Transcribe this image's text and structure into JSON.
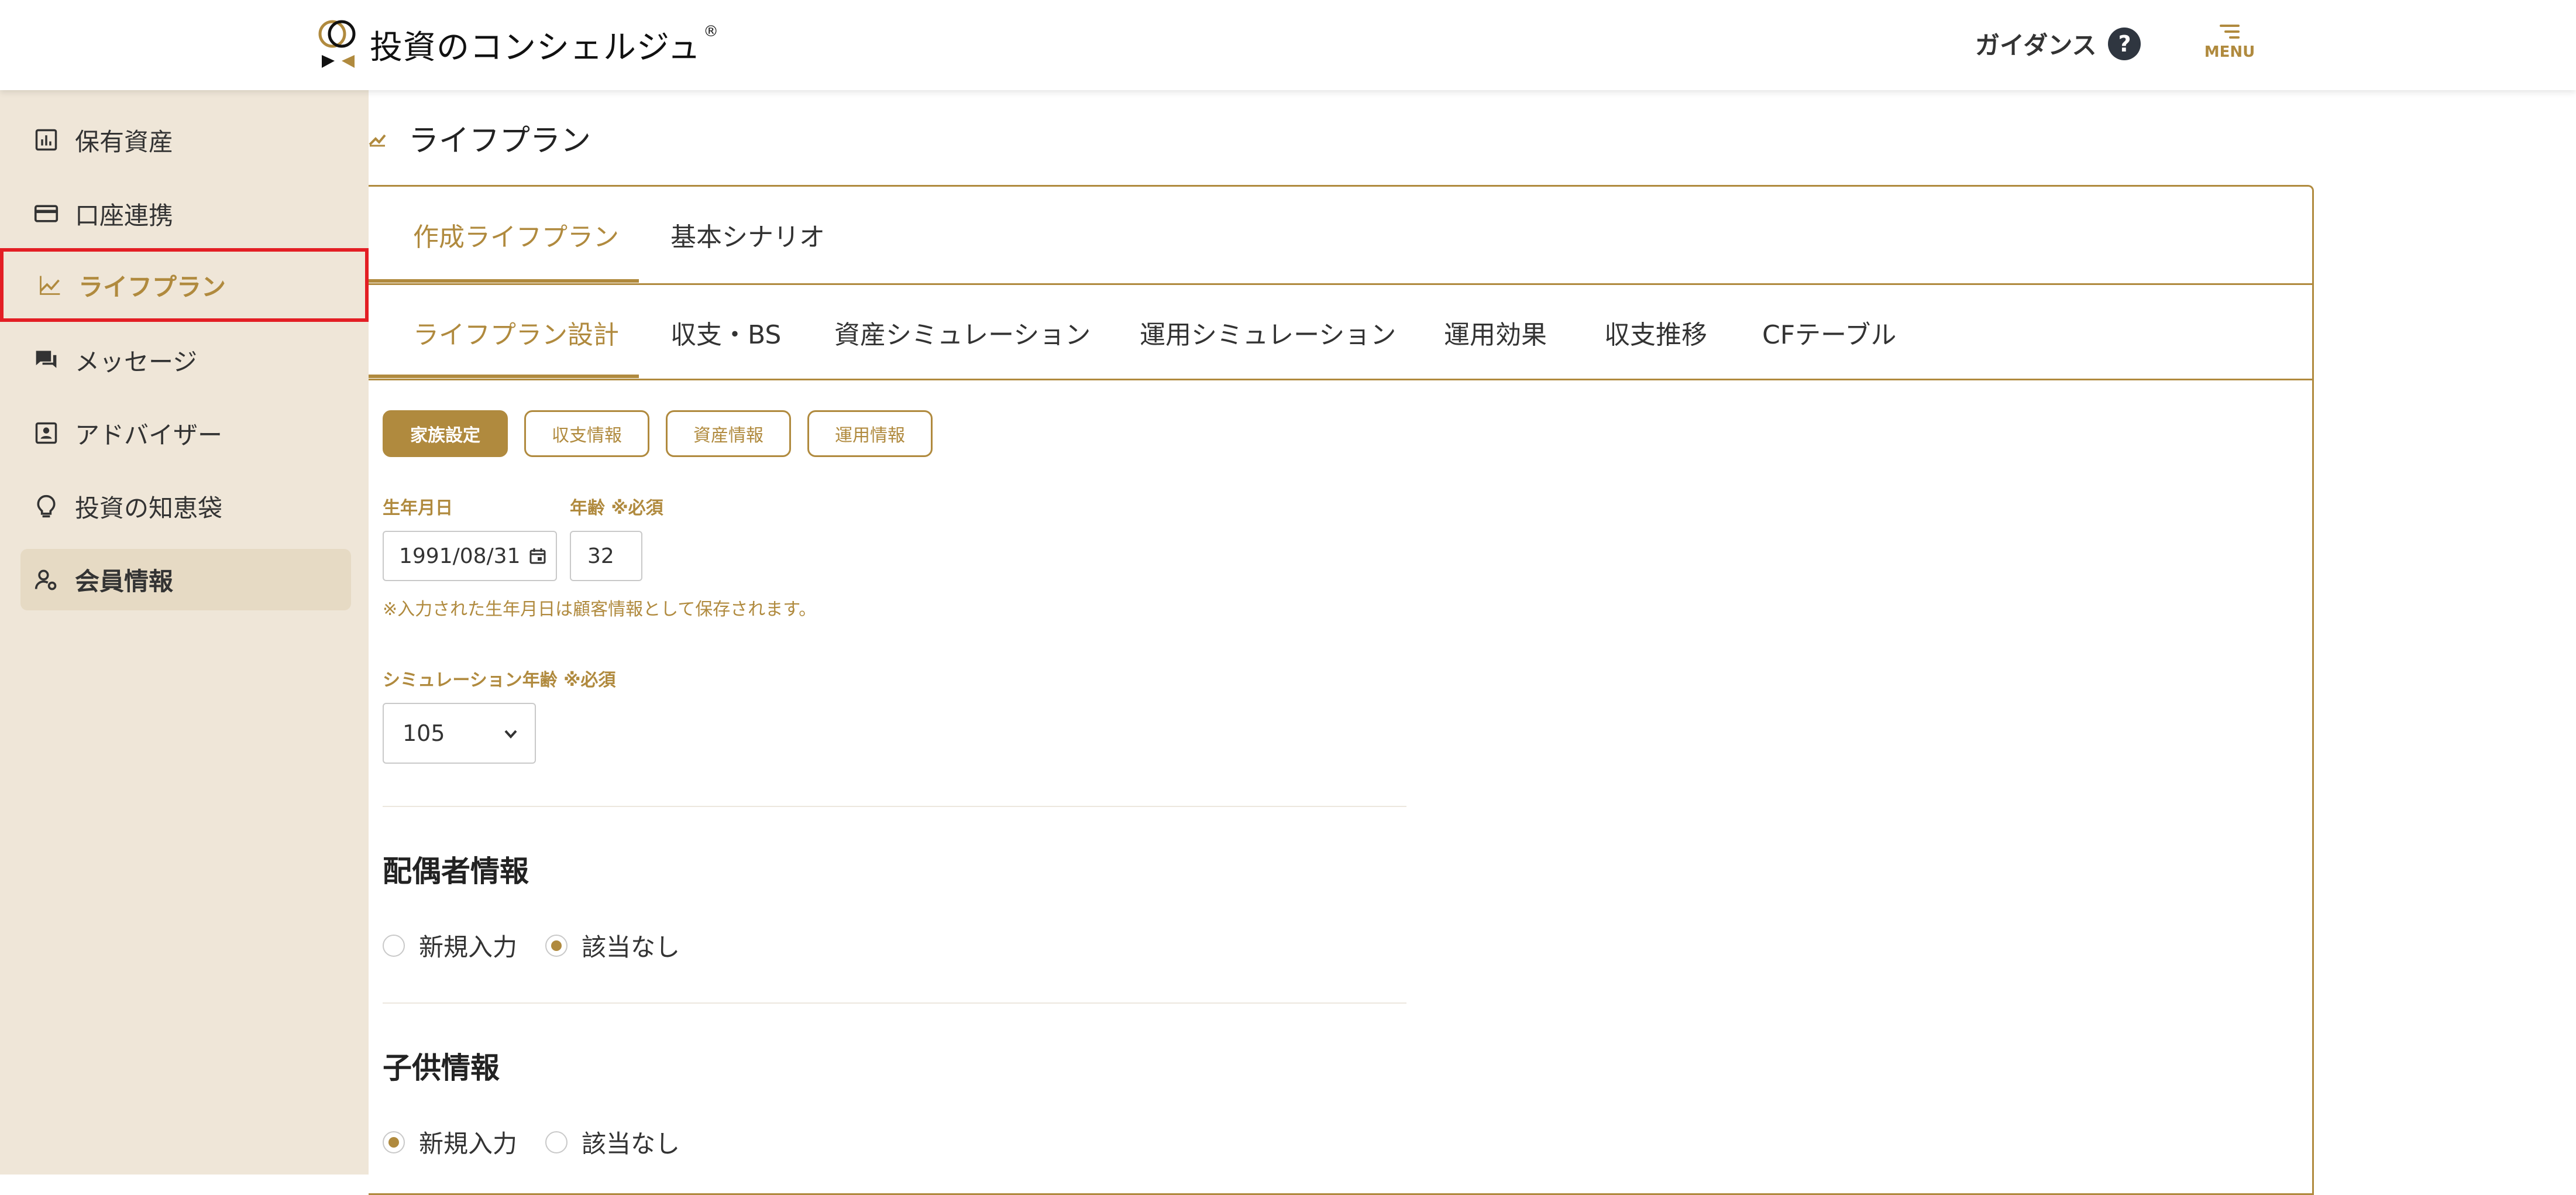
{
  "header": {
    "logo_text": "投資のコンシェルジュ",
    "logo_reg": "®",
    "guidance_label": "ガイダンス",
    "guidance_icon": "?",
    "menu_label": "MENU"
  },
  "sidebar": {
    "items": [
      {
        "label": "保有資産",
        "icon": "bar-chart-icon"
      },
      {
        "label": "口座連携",
        "icon": "credit-card-icon"
      },
      {
        "label": "ライフプラン",
        "icon": "trending-up-icon"
      },
      {
        "label": "メッセージ",
        "icon": "chat-icon"
      },
      {
        "label": "アドバイザー",
        "icon": "contact-card-icon"
      },
      {
        "label": "投資の知恵袋",
        "icon": "lightbulb-icon"
      },
      {
        "label": "会員情報",
        "icon": "user-settings-icon"
      }
    ]
  },
  "page": {
    "title": "ライフプラン"
  },
  "tabs_primary": [
    "作成ライフプラン",
    "基本シナリオ"
  ],
  "tabs_secondary": [
    "ライフプラン設計",
    "収支・BS",
    "資産シミュレーション",
    "運用シミュレーション",
    "運用効果",
    "収支推移",
    "CFテーブル"
  ],
  "chips": [
    "家族設定",
    "収支情報",
    "資産情報",
    "運用情報"
  ],
  "form": {
    "birthdate_label": "生年月日",
    "birthdate_value": "1991/08/31",
    "age_label": "年齢 ※必須",
    "age_value": "32",
    "birthdate_note": "※入力された生年月日は顧客情報として保存されます。",
    "sim_age_label": "シミュレーション年齢 ※必須",
    "sim_age_value": "105"
  },
  "spouse": {
    "title": "配偶者情報",
    "options": [
      "新規入力",
      "該当なし"
    ],
    "selected": "該当なし"
  },
  "children": {
    "title": "子供情報",
    "options": [
      "新規入力",
      "該当なし"
    ],
    "selected": "新規入力"
  },
  "colors": {
    "accent": "#b08a3e",
    "sidebar_bg": "#efe6d8",
    "highlight": "#e31e24"
  }
}
